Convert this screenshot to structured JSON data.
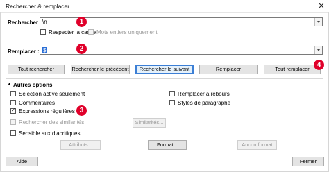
{
  "window": {
    "title": "Rechercher & remplacer",
    "close_glyph": "✕"
  },
  "search": {
    "label": "Rechercher :",
    "value": "\\n"
  },
  "options_row1": {
    "match_case": {
      "label": "Respecter la casse",
      "checked": false
    },
    "whole_words": {
      "label": "Mots entiers uniquement",
      "checked": false,
      "disabled": true
    }
  },
  "replace": {
    "label": "Remplacer :",
    "value": "$"
  },
  "buttons": {
    "find_all": "Tout rechercher",
    "find_prev": "Rechercher le précédent",
    "find_next": "Rechercher le suivant",
    "replace": "Remplacer",
    "replace_all": "Tout remplacer"
  },
  "other_options": {
    "header": "Autres options",
    "expander_glyph": "▲",
    "active_selection": "Sélection active seulement",
    "comments": "Commentaires",
    "regex": "Expressions régulières",
    "similarity": "Rechercher des similarités",
    "similarities_button": "Similarités...",
    "diacritics": "Sensible aux diacritiques",
    "backwards": "Remplacer à rebours",
    "paragraph_styles": "Styles de paragraphe",
    "attributes_button": "Attributs...",
    "format_button": "Format...",
    "no_format_button": "Aucun format"
  },
  "footer": {
    "help": "Aide",
    "close": "Fermer"
  },
  "annotations": {
    "n1": "1",
    "n2": "2",
    "n3": "3",
    "n4": "4"
  },
  "colors": {
    "badge": "#e0002a",
    "selection": "#2b6fd6",
    "default_button_border": "#3c7fd5"
  }
}
